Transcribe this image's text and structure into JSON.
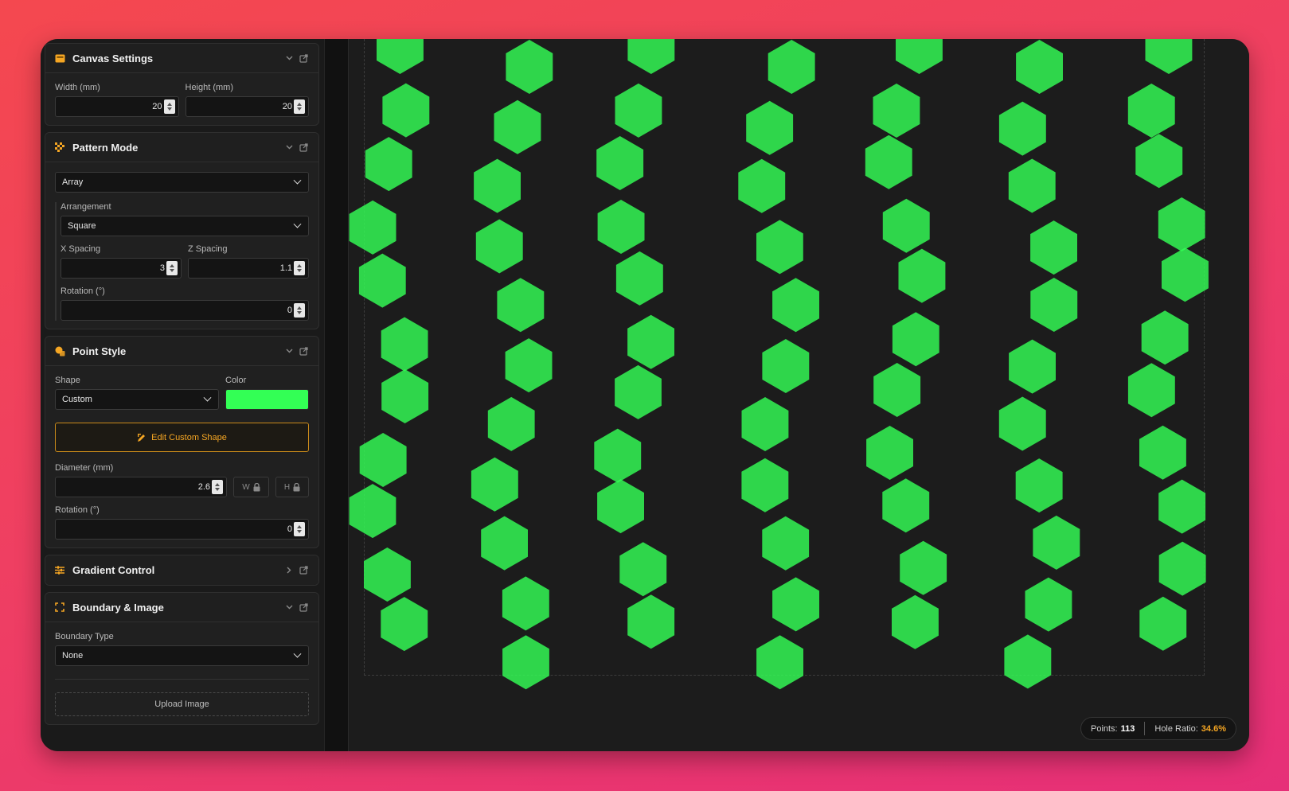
{
  "colors": {
    "accent": "#f5a623",
    "point_fill": "#33ff55",
    "background": "#1c1c1c"
  },
  "canvas_settings": {
    "title": "Canvas Settings",
    "icon": "canvas-icon",
    "width_label": "Width (mm)",
    "width_value": "20",
    "height_label": "Height (mm)",
    "height_value": "20"
  },
  "pattern_mode": {
    "title": "Pattern Mode",
    "icon": "pattern-icon",
    "mode_value": "Array",
    "arrangement_label": "Arrangement",
    "arrangement_value": "Square",
    "x_spacing_label": "X Spacing",
    "x_spacing_value": "3",
    "z_spacing_label": "Z Spacing",
    "z_spacing_value": "1.1",
    "rotation_label": "Rotation (°)",
    "rotation_value": "0"
  },
  "point_style": {
    "title": "Point Style",
    "icon": "shapes-icon",
    "shape_label": "Shape",
    "shape_value": "Custom",
    "color_label": "Color",
    "color_value": "#33ff55",
    "edit_button": "Edit Custom Shape",
    "diameter_label": "Diameter (mm)",
    "diameter_value": "2.6",
    "w_lock": "W",
    "h_lock": "H",
    "rotation_label": "Rotation (°)",
    "rotation_value": "0"
  },
  "gradient_control": {
    "title": "Gradient Control",
    "icon": "sliders-icon"
  },
  "boundary_image": {
    "title": "Boundary & Image",
    "icon": "boundary-icon",
    "boundary_type_label": "Boundary Type",
    "boundary_type_value": "None",
    "upload_button": "Upload Image"
  },
  "status": {
    "points_label": "Points:",
    "points_value": "113",
    "hole_ratio_label": "Hole Ratio:",
    "hole_ratio_value": "34.6%"
  }
}
